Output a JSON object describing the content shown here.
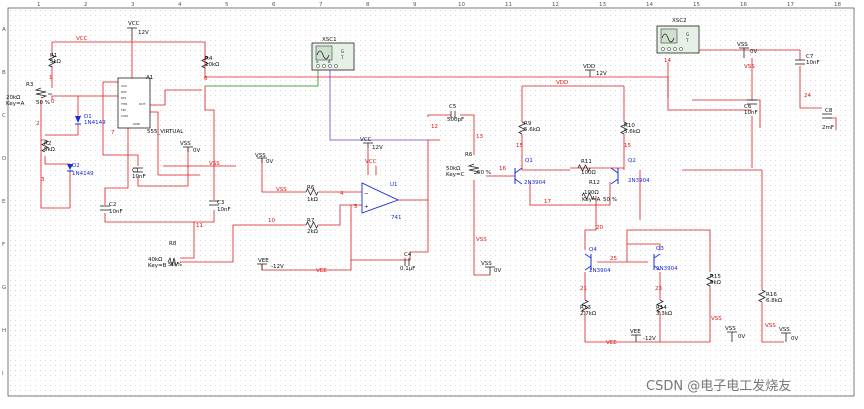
{
  "ruler": {
    "cols": [
      "1",
      "2",
      "3",
      "4",
      "5",
      "6",
      "7",
      "8",
      "9",
      "10",
      "11",
      "12",
      "13",
      "14",
      "15",
      "16",
      "17",
      "18"
    ],
    "rows": [
      "A",
      "B",
      "C",
      "D",
      "E",
      "F",
      "G",
      "H",
      "I"
    ]
  },
  "instruments": {
    "xsc1": "XSC1",
    "xsc2": "XSC2",
    "ports": [
      "G",
      "T",
      "A",
      "B"
    ]
  },
  "components": {
    "vcc_top": {
      "name": "VCC",
      "value": "12V"
    },
    "r1": {
      "name": "R1",
      "value": "5kΩ"
    },
    "r3": {
      "name": "R3",
      "value": "20kΩ",
      "key": "Key=A",
      "pct": "50 %"
    },
    "r2": {
      "name": "R2",
      "value": "5kΩ"
    },
    "r4": {
      "name": "R4",
      "value": "10kΩ"
    },
    "d1": {
      "name": "D1",
      "value": "1N4149"
    },
    "d2": {
      "name": "D2",
      "value": "1N4149"
    },
    "a1": {
      "name": "A1",
      "value": "555_VIRTUAL",
      "pins": [
        "VCC",
        "RST",
        "DIS",
        "THR",
        "TRI",
        "CON",
        "OUT",
        "GND"
      ]
    },
    "c1": {
      "name": "C1",
      "value": "10nF"
    },
    "c2": {
      "name": "C2",
      "value": "10nF"
    },
    "c3": {
      "name": "C3",
      "value": "10nF"
    },
    "r8": {
      "name": "R8",
      "value": "40kΩ",
      "key": "Key=B",
      "pct": "50 %"
    },
    "vss1": {
      "name": "VSS",
      "value": "0V"
    },
    "vss2": {
      "name": "VSS",
      "value": "0V"
    },
    "vcc_op": {
      "name": "VCC",
      "value": "12V"
    },
    "r6": {
      "name": "R6",
      "value": "1kΩ"
    },
    "r7": {
      "name": "R7",
      "value": "2kΩ"
    },
    "u1": {
      "name": "U1",
      "value": "741"
    },
    "c4": {
      "name": "C4",
      "value": "0.1µF"
    },
    "vee1": {
      "name": "VEE",
      "value": "-12V"
    },
    "c5": {
      "name": "C5",
      "value": "500pF"
    },
    "r6b": {
      "name": "R6",
      "value": "50kΩ",
      "key": "Key=C",
      "pct": "50 %"
    },
    "vss3": {
      "name": "VSS",
      "value": "0V"
    },
    "vdd": {
      "name": "VDD",
      "value": "12V"
    },
    "r9": {
      "name": "R9",
      "value": "5.6kΩ"
    },
    "r10": {
      "name": "R10",
      "value": "5.6kΩ"
    },
    "r11": {
      "name": "R11",
      "value": "100Ω"
    },
    "r12": {
      "name": "R12",
      "value": "100Ω",
      "key": "Key=A",
      "pct": "50 %"
    },
    "q1": {
      "name": "Q1",
      "value": "2N3904"
    },
    "q2": {
      "name": "Q2",
      "value": "2N3904"
    },
    "q3": {
      "name": "Q3",
      "value": "2N3904"
    },
    "q4": {
      "name": "Q4",
      "value": "2N3904"
    },
    "r13": {
      "name": "R13",
      "value": "2.7kΩ"
    },
    "r14": {
      "name": "R14",
      "value": "3.3kΩ"
    },
    "r15": {
      "name": "R15",
      "value": "5kΩ"
    },
    "r16": {
      "name": "R16",
      "value": "6.8kΩ"
    },
    "vee2": {
      "name": "VEE",
      "value": "-12V"
    },
    "vss4": {
      "name": "VSS",
      "value": "0V"
    },
    "vss5": {
      "name": "VSS",
      "value": "0V"
    },
    "vss6": {
      "name": "VSS",
      "value": "0V"
    },
    "c6": {
      "name": "C6",
      "value": "10nF"
    },
    "c7": {
      "name": "C7",
      "value": "10nF"
    },
    "c8": {
      "name": "C8",
      "value": "2mF"
    }
  },
  "nets": {
    "vcc": "VCC",
    "vss": "VSS",
    "vee": "VEE",
    "vdd": "VDD",
    "n0": "0",
    "n1": "1",
    "n2": "2",
    "n3": "3",
    "n4": "4",
    "n5": "5",
    "n6": "6",
    "n7": "7",
    "n10": "10",
    "n11": "11",
    "n12": "12",
    "n13": "13",
    "n14": "14",
    "n15": "15",
    "n16": "16",
    "n17": "17",
    "n20": "20",
    "n21": "21",
    "n23": "23",
    "n24": "24",
    "n25": "25"
  },
  "watermark": "CSDN @电子电工发烧友"
}
